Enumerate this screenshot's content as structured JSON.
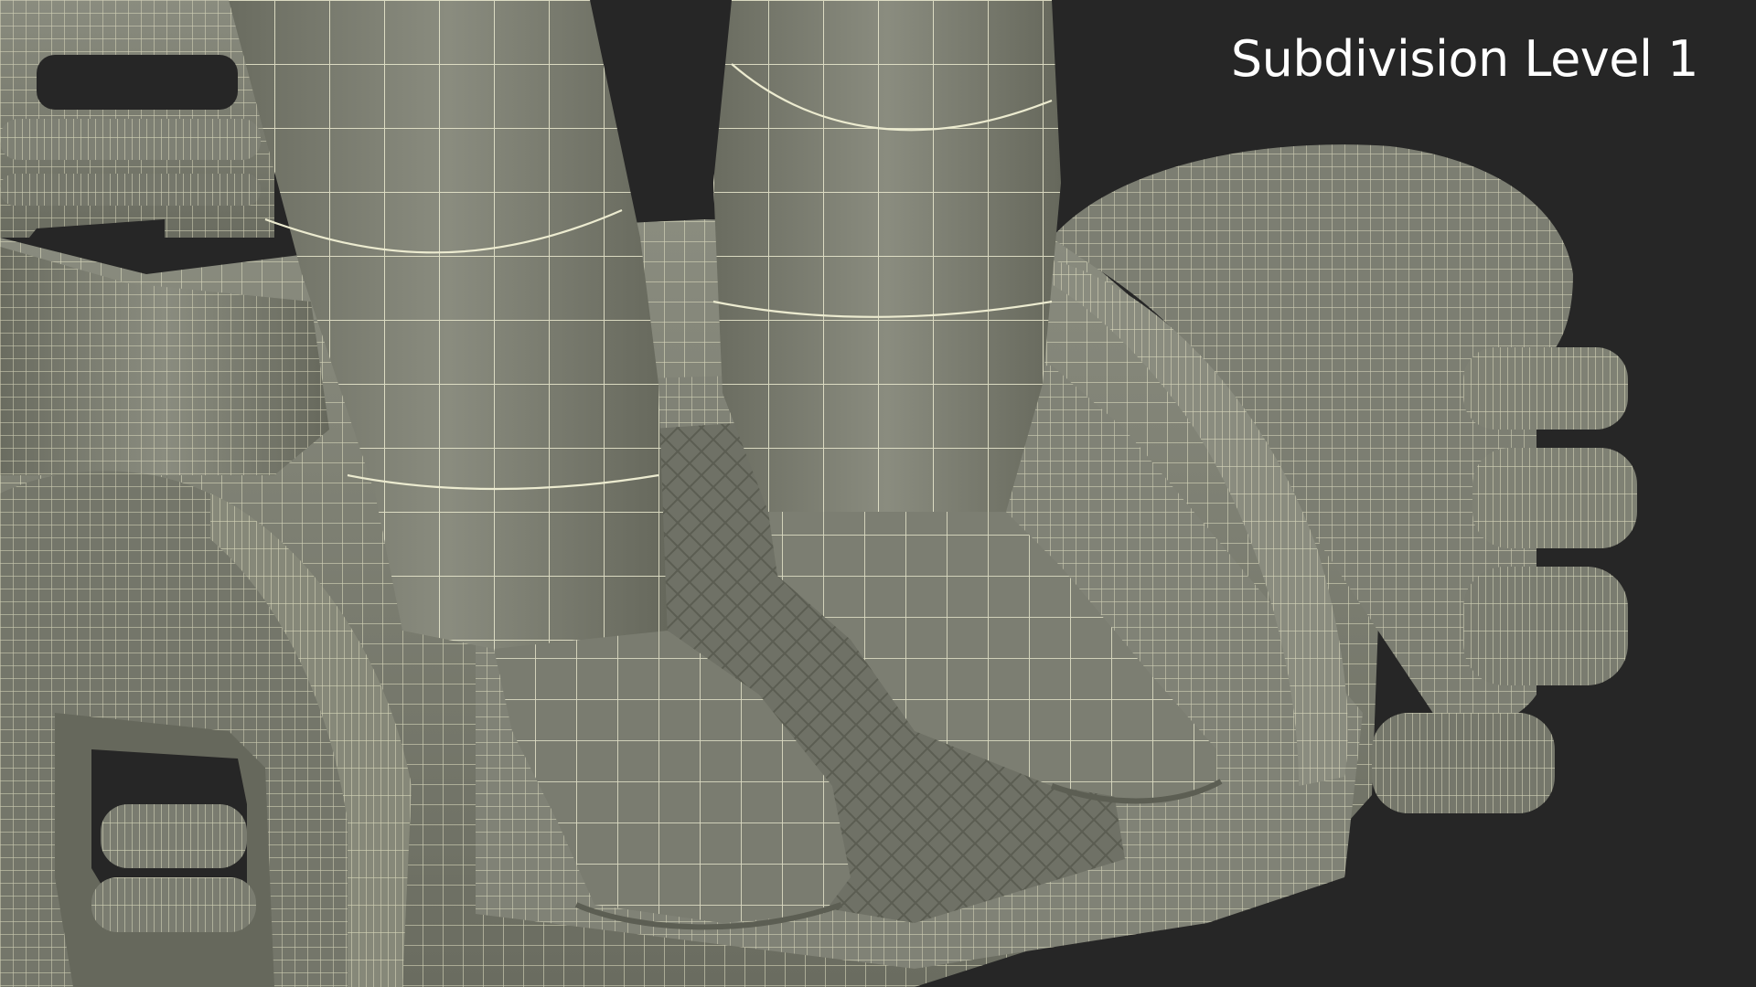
{
  "scene": {
    "caption": "Subdivision Level 1",
    "background_color": "#262626",
    "mesh_fill_color": "#7d7f72",
    "mesh_shadow_color": "#4a4c44",
    "wire_color": "#e8e6c8"
  }
}
